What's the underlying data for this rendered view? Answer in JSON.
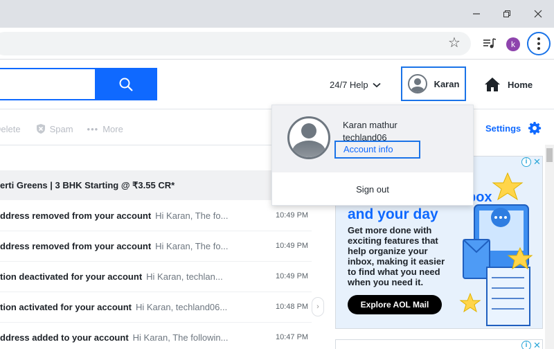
{
  "browser": {
    "profile_initial": "k"
  },
  "header": {
    "help_label": "24/7 Help",
    "account_label": "Karan",
    "home_label": "Home"
  },
  "actions": {
    "delete_label": "Delete",
    "spam_label": "Spam",
    "more_label": "More",
    "settings_label": "Settings"
  },
  "promo_row": {
    "text": "erti Greens | 3 BHK Starting @ ₹3.55 CR*"
  },
  "messages": [
    {
      "subject": "ddress removed from your account",
      "preview": "Hi Karan, The fo...",
      "time": "10:49 PM"
    },
    {
      "subject": "ddress removed from your account",
      "preview": "Hi Karan, The fo...",
      "time": "10:49 PM"
    },
    {
      "subject": "tion deactivated for your account",
      "preview": "Hi Karan, techlan...",
      "time": "10:49 PM"
    },
    {
      "subject": "tion activated for your account",
      "preview": "Hi Karan, techland06...",
      "time": "10:48 PM"
    },
    {
      "subject": "ddress added to your account",
      "preview": "Hi Karan, The followin...",
      "time": "10:47 PM"
    }
  ],
  "ad": {
    "headline_partial": "box",
    "headline": "and your day",
    "body": "Get more done with exciting features that help organize your inbox, making it easier to find what you need when you need it.",
    "cta": "Explore AOL Mail"
  },
  "dropdown": {
    "name": "Karan mathur",
    "email": "techland06",
    "account_info": "Account info",
    "sign_out": "Sign out"
  },
  "colors": {
    "brand_blue": "#0f69ff",
    "focus_ring": "#1a73e8"
  }
}
